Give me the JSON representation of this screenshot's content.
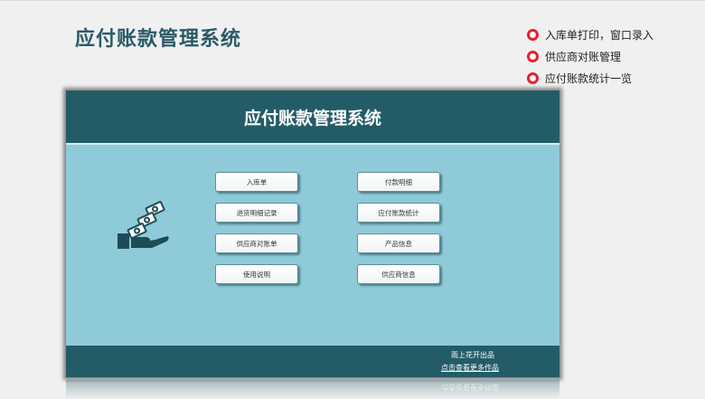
{
  "page": {
    "title": "应付账款管理系统"
  },
  "features": [
    {
      "text": "入库单打印，窗口录入"
    },
    {
      "text": "供应商对账管理"
    },
    {
      "text": "应付账款统计一览"
    }
  ],
  "panel": {
    "header_title": "应付账款管理系统",
    "left_menu": [
      {
        "label": "入库单"
      },
      {
        "label": "进货明细记录"
      },
      {
        "label": "供应商对账单"
      },
      {
        "label": "使用说明"
      }
    ],
    "right_menu": [
      {
        "label": "付款明细"
      },
      {
        "label": "应付账款统计"
      },
      {
        "label": "产品信息"
      },
      {
        "label": "供应商信息"
      }
    ],
    "footer_line1": "雨上花开出品",
    "footer_line2": "点击查看更多作品"
  },
  "colors": {
    "header": "#235c67",
    "panel_body": "#8fcad9",
    "title_text": "#2a5a68",
    "bullet": "#e8202a"
  },
  "icons": {
    "illustration": "hand-holding-money-icon",
    "bullet": "red-ring-bullet-icon"
  }
}
